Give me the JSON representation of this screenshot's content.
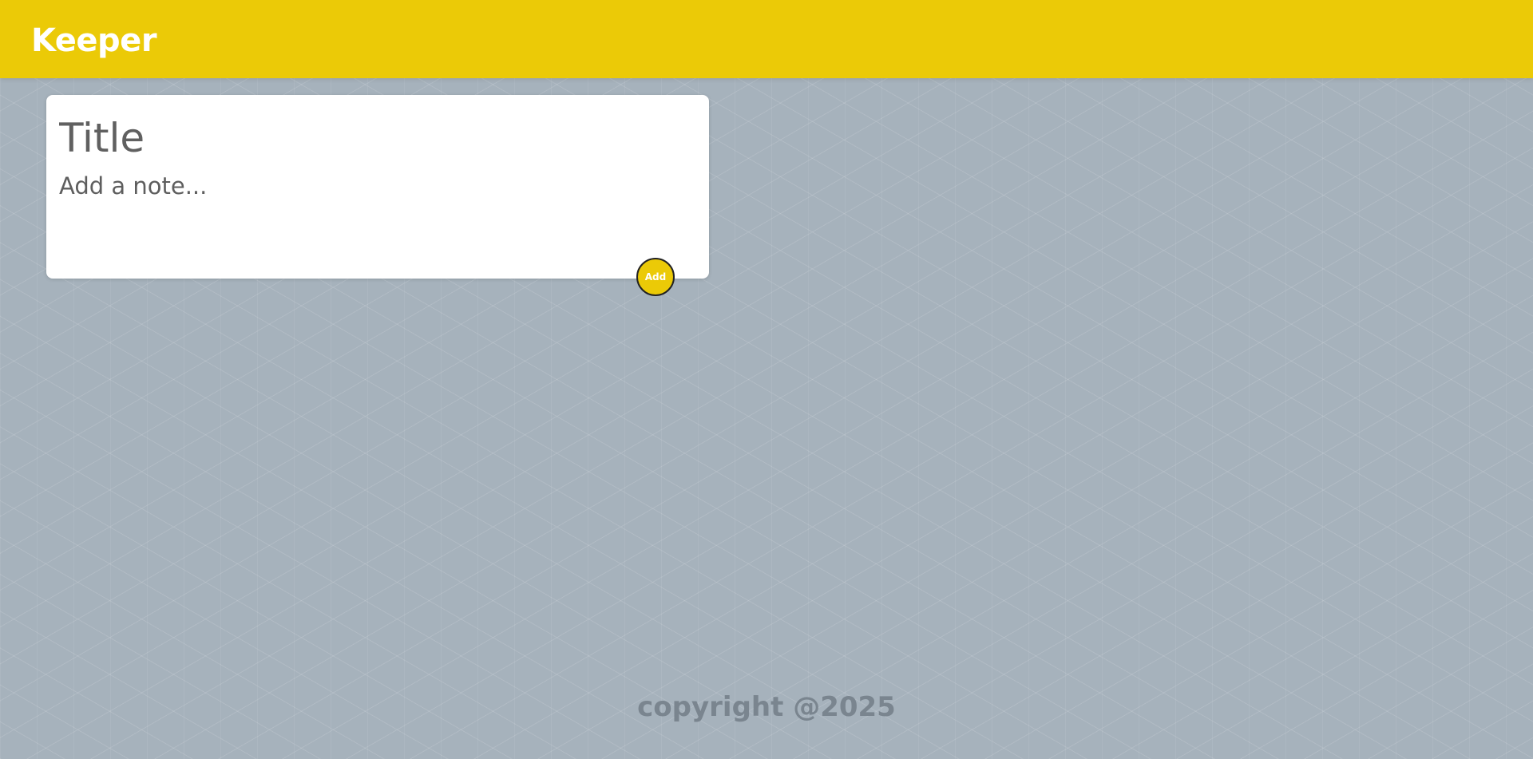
{
  "header": {
    "logo_text": "Keeper"
  },
  "note_form": {
    "title_placeholder": "Title",
    "content_placeholder": "Add a note...",
    "add_button_label": "Add"
  },
  "footer": {
    "copyright_text": "copyright @2025"
  },
  "colors": {
    "header_background": "#ebca07",
    "page_background": "#a6b2bc",
    "card_background": "#ffffff",
    "footer_text": "#7a858f"
  }
}
